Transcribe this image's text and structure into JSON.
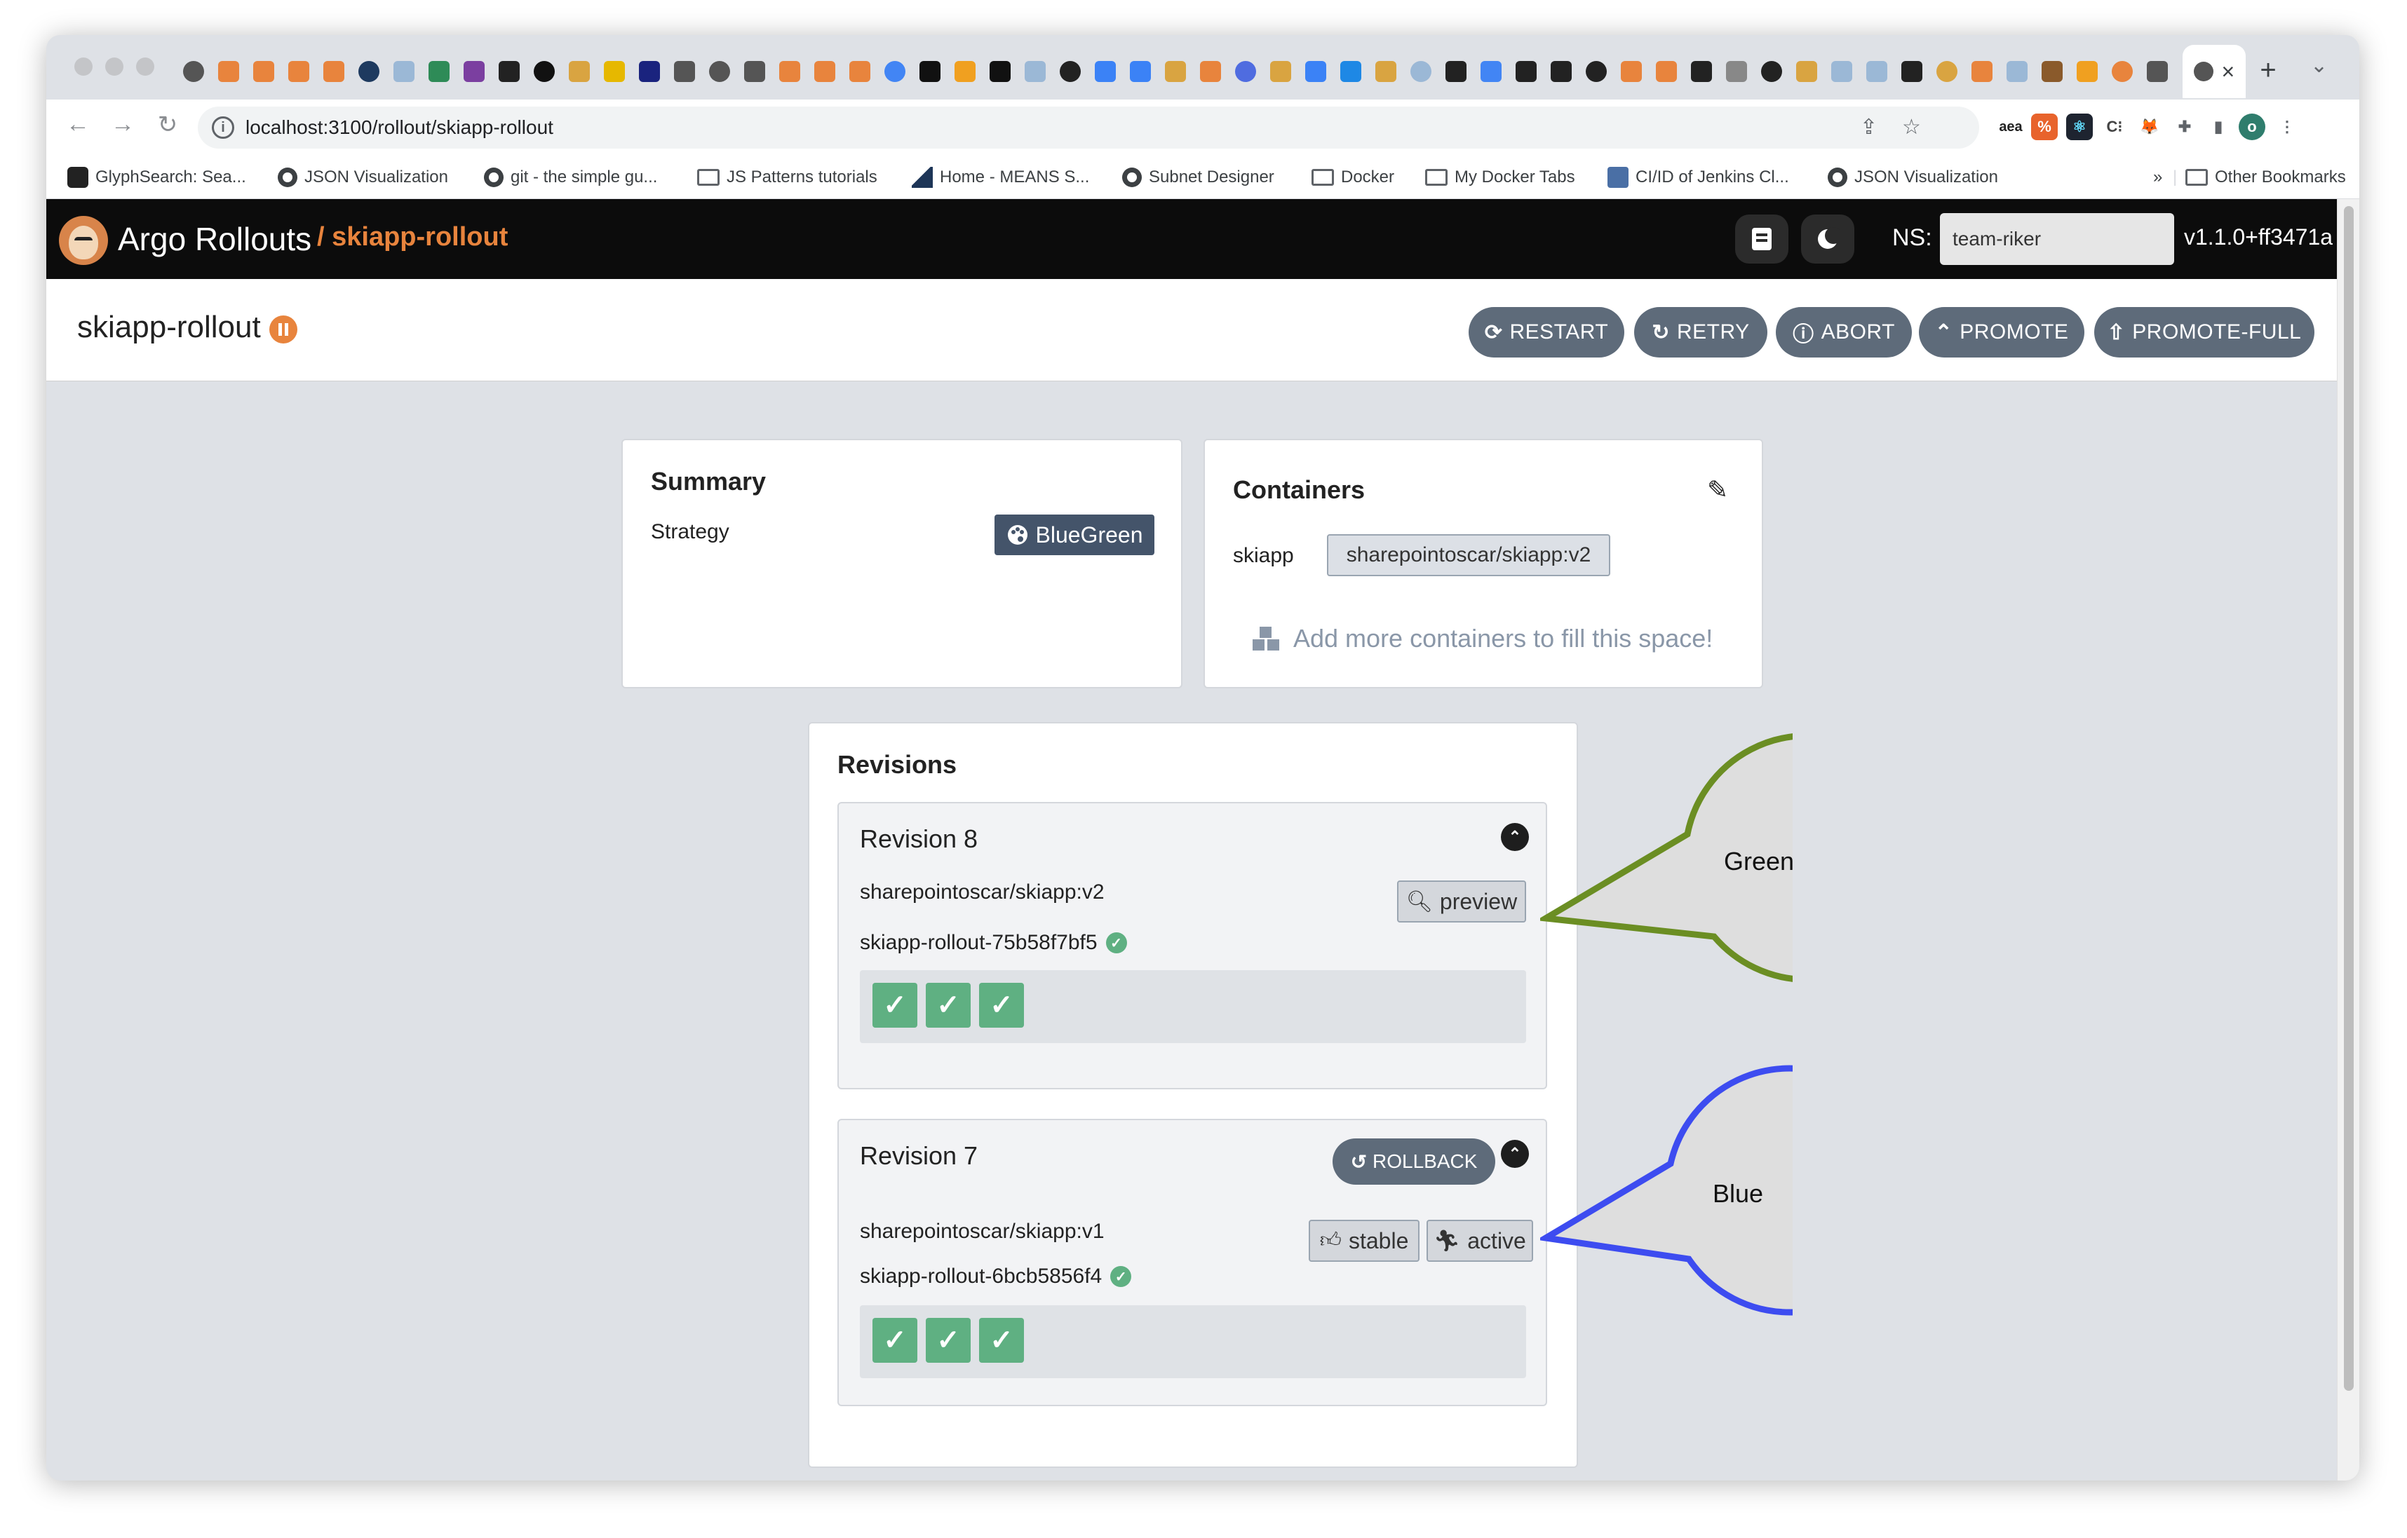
{
  "browser": {
    "url": "localhost:3100/rollout/skiapp-rollout",
    "tab_close": "×",
    "new_tab": "+",
    "tab_menu": "⌄",
    "bookmarks": [
      {
        "label": "GlyphSearch: Sea...",
        "icon": "glyphsearch-icon"
      },
      {
        "label": "JSON Visualization",
        "icon": "globe-icon"
      },
      {
        "label": "git - the simple gu...",
        "icon": "globe-icon"
      },
      {
        "label": "JS Patterns tutorials",
        "icon": "folder-icon"
      },
      {
        "label": "Home - MEANS S...",
        "icon": "means-icon"
      },
      {
        "label": "Subnet Designer",
        "icon": "globe-icon"
      },
      {
        "label": "Docker",
        "icon": "folder-icon"
      },
      {
        "label": "My Docker Tabs",
        "icon": "folder-icon"
      },
      {
        "label": "CI/ID of Jenkins Cl...",
        "icon": "jenkins-icon"
      },
      {
        "label": "JSON Visualization",
        "icon": "globe-icon"
      }
    ],
    "bookmarks_more": "»",
    "other_bookmarks": "Other Bookmarks",
    "profile_initial": "o"
  },
  "app": {
    "name": "Argo Rollouts",
    "breadcrumb": "/ skiapp-rollout",
    "ns_label": "NS:",
    "ns_value": "team-riker",
    "version": "v1.1.0+ff3471a",
    "accent_color": "#e8843d"
  },
  "rollout": {
    "name": "skiapp-rollout",
    "status_icon": "pause-icon",
    "actions": {
      "restart": "RESTART",
      "retry": "RETRY",
      "abort": "ABORT",
      "promote": "PROMOTE",
      "promote_full": "PROMOTE-FULL"
    }
  },
  "summary": {
    "title": "Summary",
    "strategy_label": "Strategy",
    "strategy_value": "BlueGreen"
  },
  "containers": {
    "title": "Containers",
    "name": "skiapp",
    "image": "sharepointoscar/skiapp:v2",
    "add_more": "Add more containers to fill this space!"
  },
  "revisions": {
    "title": "Revisions",
    "items": [
      {
        "title": "Revision 8",
        "image": "sharepointoscar/skiapp:v2",
        "replicaset": "skiapp-rollout-75b58f7bf5",
        "badges": [
          "preview"
        ],
        "pods": 3
      },
      {
        "title": "Revision 7",
        "rollback": "ROLLBACK",
        "image": "sharepointoscar/skiapp:v1",
        "replicaset": "skiapp-rollout-6bcb5856f4",
        "badges": [
          "stable",
          "active"
        ],
        "pods": 3
      }
    ]
  },
  "annotations": {
    "green": {
      "label": "Green",
      "color": "#6b8e23"
    },
    "blue": {
      "label": "Blue",
      "color": "#3d4cf0"
    }
  }
}
